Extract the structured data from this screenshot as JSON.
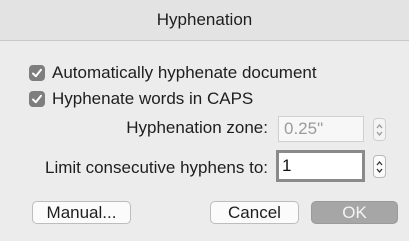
{
  "dialog": {
    "title": "Hyphenation"
  },
  "options": {
    "auto_hyphenate": {
      "label": "Automatically hyphenate document",
      "checked": true
    },
    "hyphenate_caps": {
      "label": "Hyphenate words in CAPS",
      "checked": true
    }
  },
  "zone": {
    "label": "Hyphenation zone:",
    "value": "0.25\""
  },
  "limit": {
    "label": "Limit consecutive hyphens to:",
    "value": "1"
  },
  "buttons": {
    "manual": "Manual...",
    "cancel": "Cancel",
    "ok": "OK"
  }
}
